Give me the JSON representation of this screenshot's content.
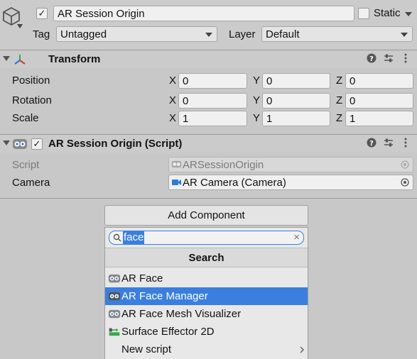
{
  "object": {
    "name": "AR Session Origin",
    "active_checked": true,
    "static_label": "Static",
    "tag_label": "Tag",
    "tag_value": "Untagged",
    "layer_label": "Layer",
    "layer_value": "Default"
  },
  "transform": {
    "title": "Transform",
    "rows": [
      {
        "label": "Position",
        "x": "0",
        "y": "0",
        "z": "0"
      },
      {
        "label": "Rotation",
        "x": "0",
        "y": "0",
        "z": "0"
      },
      {
        "label": "Scale",
        "x": "1",
        "y": "1",
        "z": "1"
      }
    ],
    "axis_x": "X",
    "axis_y": "Y",
    "axis_z": "Z"
  },
  "script_component": {
    "title": "AR Session Origin (Script)",
    "enabled_checked": true,
    "script_label": "Script",
    "script_value": "ARSessionOrigin",
    "camera_label": "Camera",
    "camera_value": "AR Camera (Camera)"
  },
  "add_component": {
    "button_label": "Add Component",
    "search_value": "face",
    "clear_glyph": "×",
    "menu_title": "Search",
    "items": [
      {
        "label": "AR Face",
        "icon": "script-icon",
        "selected": false
      },
      {
        "label": "AR Face Manager",
        "icon": "script-icon",
        "selected": true
      },
      {
        "label": "AR Face Mesh Visualizer",
        "icon": "script-icon",
        "selected": false
      },
      {
        "label": "Surface Effector 2D",
        "icon": "effector-icon",
        "selected": false
      },
      {
        "label": "New script",
        "icon": "",
        "selected": false
      }
    ]
  },
  "colors": {
    "selection": "#3a7fe0",
    "panel": "#c8c8c8",
    "header": "#cbcbcb"
  }
}
